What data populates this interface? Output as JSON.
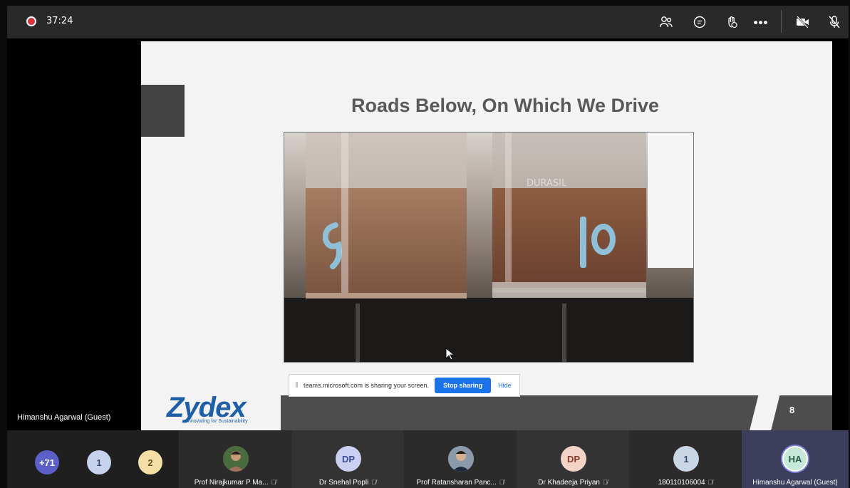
{
  "topbar": {
    "timer": "37:24",
    "icons": [
      "people-icon",
      "chat-icon",
      "raise-hand-icon",
      "more-icon",
      "camera-off-icon",
      "mic-off-icon"
    ]
  },
  "slide": {
    "title": "Roads Below, On Which We Drive",
    "logo_text": "Zydex",
    "logo_tagline": "Innovating for Sustainability",
    "page": "8"
  },
  "share_bar": {
    "message": "teams.microsoft.com is sharing your screen.",
    "stop_label": "Stop sharing",
    "hide_label": "Hide"
  },
  "stage": {
    "presenter_label": "Himanshu Agarwal (Guest)"
  },
  "strip": {
    "bubbles": [
      {
        "label": "+71",
        "color": "#5b5fc7"
      },
      {
        "label": "1",
        "color": "#c7d3ec"
      },
      {
        "label": "2",
        "color": "#f5dfa6"
      }
    ],
    "tiles": [
      {
        "name": "Prof Nirajkumar P Ma...",
        "avatar": "",
        "muted": true
      },
      {
        "name": "Dr Snehal Popli",
        "avatar": "DP",
        "muted": true
      },
      {
        "name": "Prof Ratansharan Panc...",
        "avatar": "",
        "muted": true
      },
      {
        "name": "Dr Khadeeja Priyan",
        "avatar": "DP",
        "muted": true
      },
      {
        "name": "180110106004",
        "avatar": "1",
        "muted": true
      },
      {
        "name": "Himanshu Agarwal (Guest)",
        "avatar": "HA",
        "muted": false
      }
    ]
  }
}
